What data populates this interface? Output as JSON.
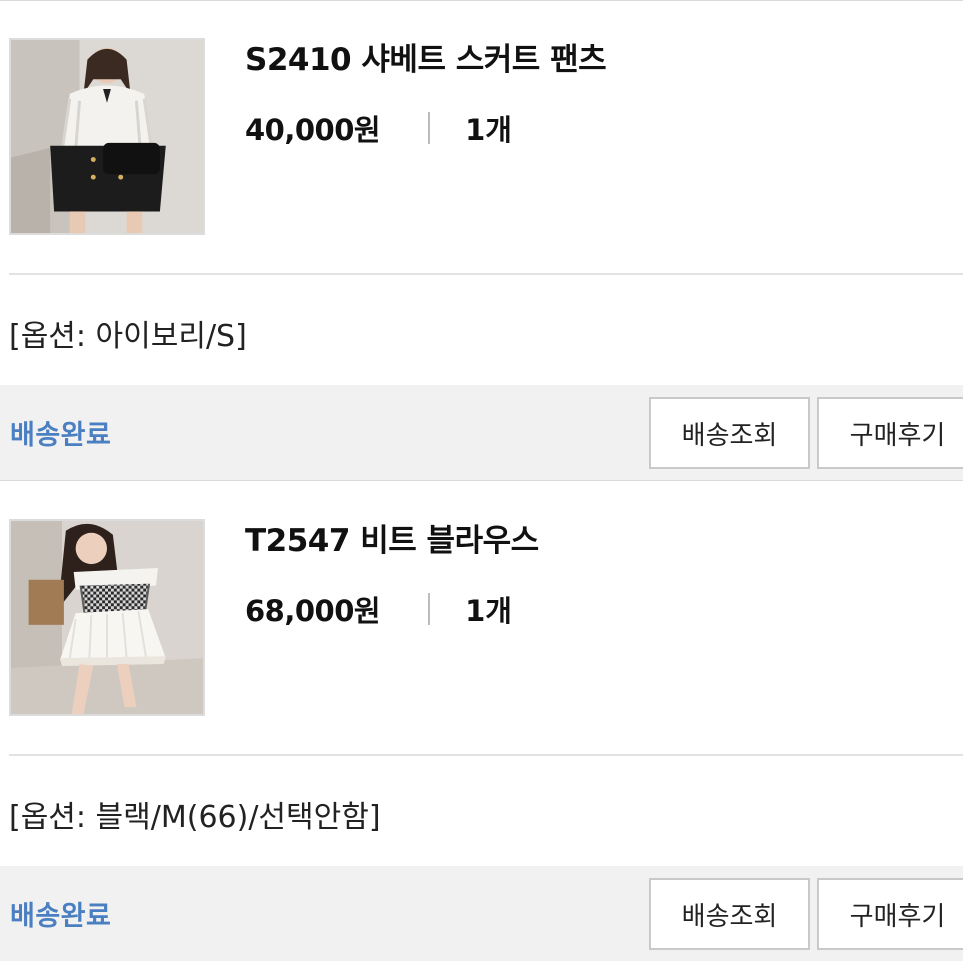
{
  "orders": [
    {
      "name": "S2410 샤베트 스커트 팬츠",
      "price": "40,000원",
      "quantity": "1개",
      "option": "[옵션: 아이보리/S]",
      "status": "배송완료",
      "buttons": {
        "track": "배송조회",
        "review": "구매후기"
      },
      "image_icon": "product-photo-skirt-pants"
    },
    {
      "name": "T2547 비트 블라우스",
      "price": "68,000원",
      "quantity": "1개",
      "option": "[옵션: 블랙/M(66)/선택안함]",
      "status": "배송완료",
      "buttons": {
        "track": "배송조회",
        "review": "구매후기"
      },
      "image_icon": "product-photo-blouse"
    }
  ],
  "colors": {
    "status_blue": "#4a7fc1",
    "status_bar_bg": "#f1f1f1",
    "border": "#c9c9c9"
  }
}
